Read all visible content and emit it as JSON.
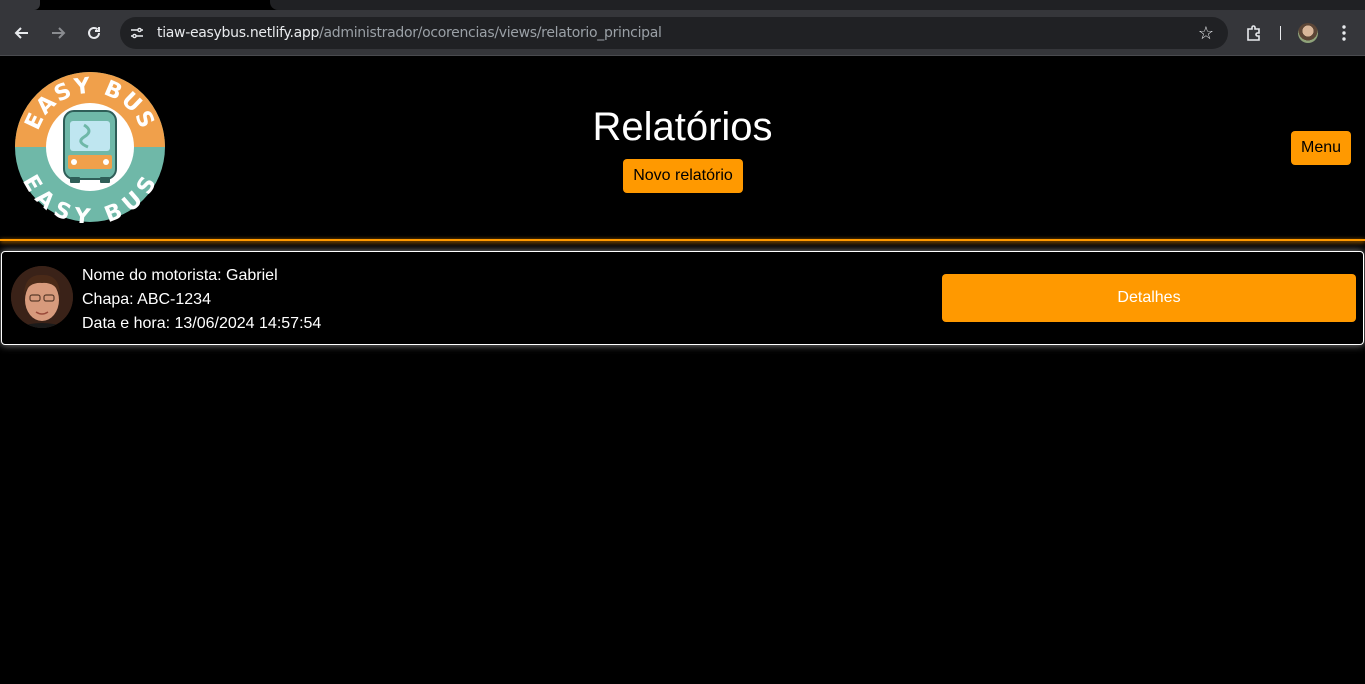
{
  "browser": {
    "url_host": "tiaw-easybus.netlify.app",
    "url_path": "/administrador/ocorencias/views/relatorio_principal"
  },
  "header": {
    "logo_text_top": "EASY BUS",
    "logo_text_bottom": "EASY BUS",
    "title": "Relatórios",
    "new_report_label": "Novo relatório",
    "menu_label": "Menu"
  },
  "reports": [
    {
      "driver_line": "Nome do motorista: Gabriel",
      "plate_line": "Chapa: ABC-1234",
      "datetime_line": "Data e hora: 13/06/2024 14:57:54",
      "details_label": "Detalhes"
    }
  ],
  "colors": {
    "accent": "#ff9900",
    "background": "#000000",
    "logo_teal": "#6fb8a8",
    "logo_orange": "#f0a04b"
  }
}
